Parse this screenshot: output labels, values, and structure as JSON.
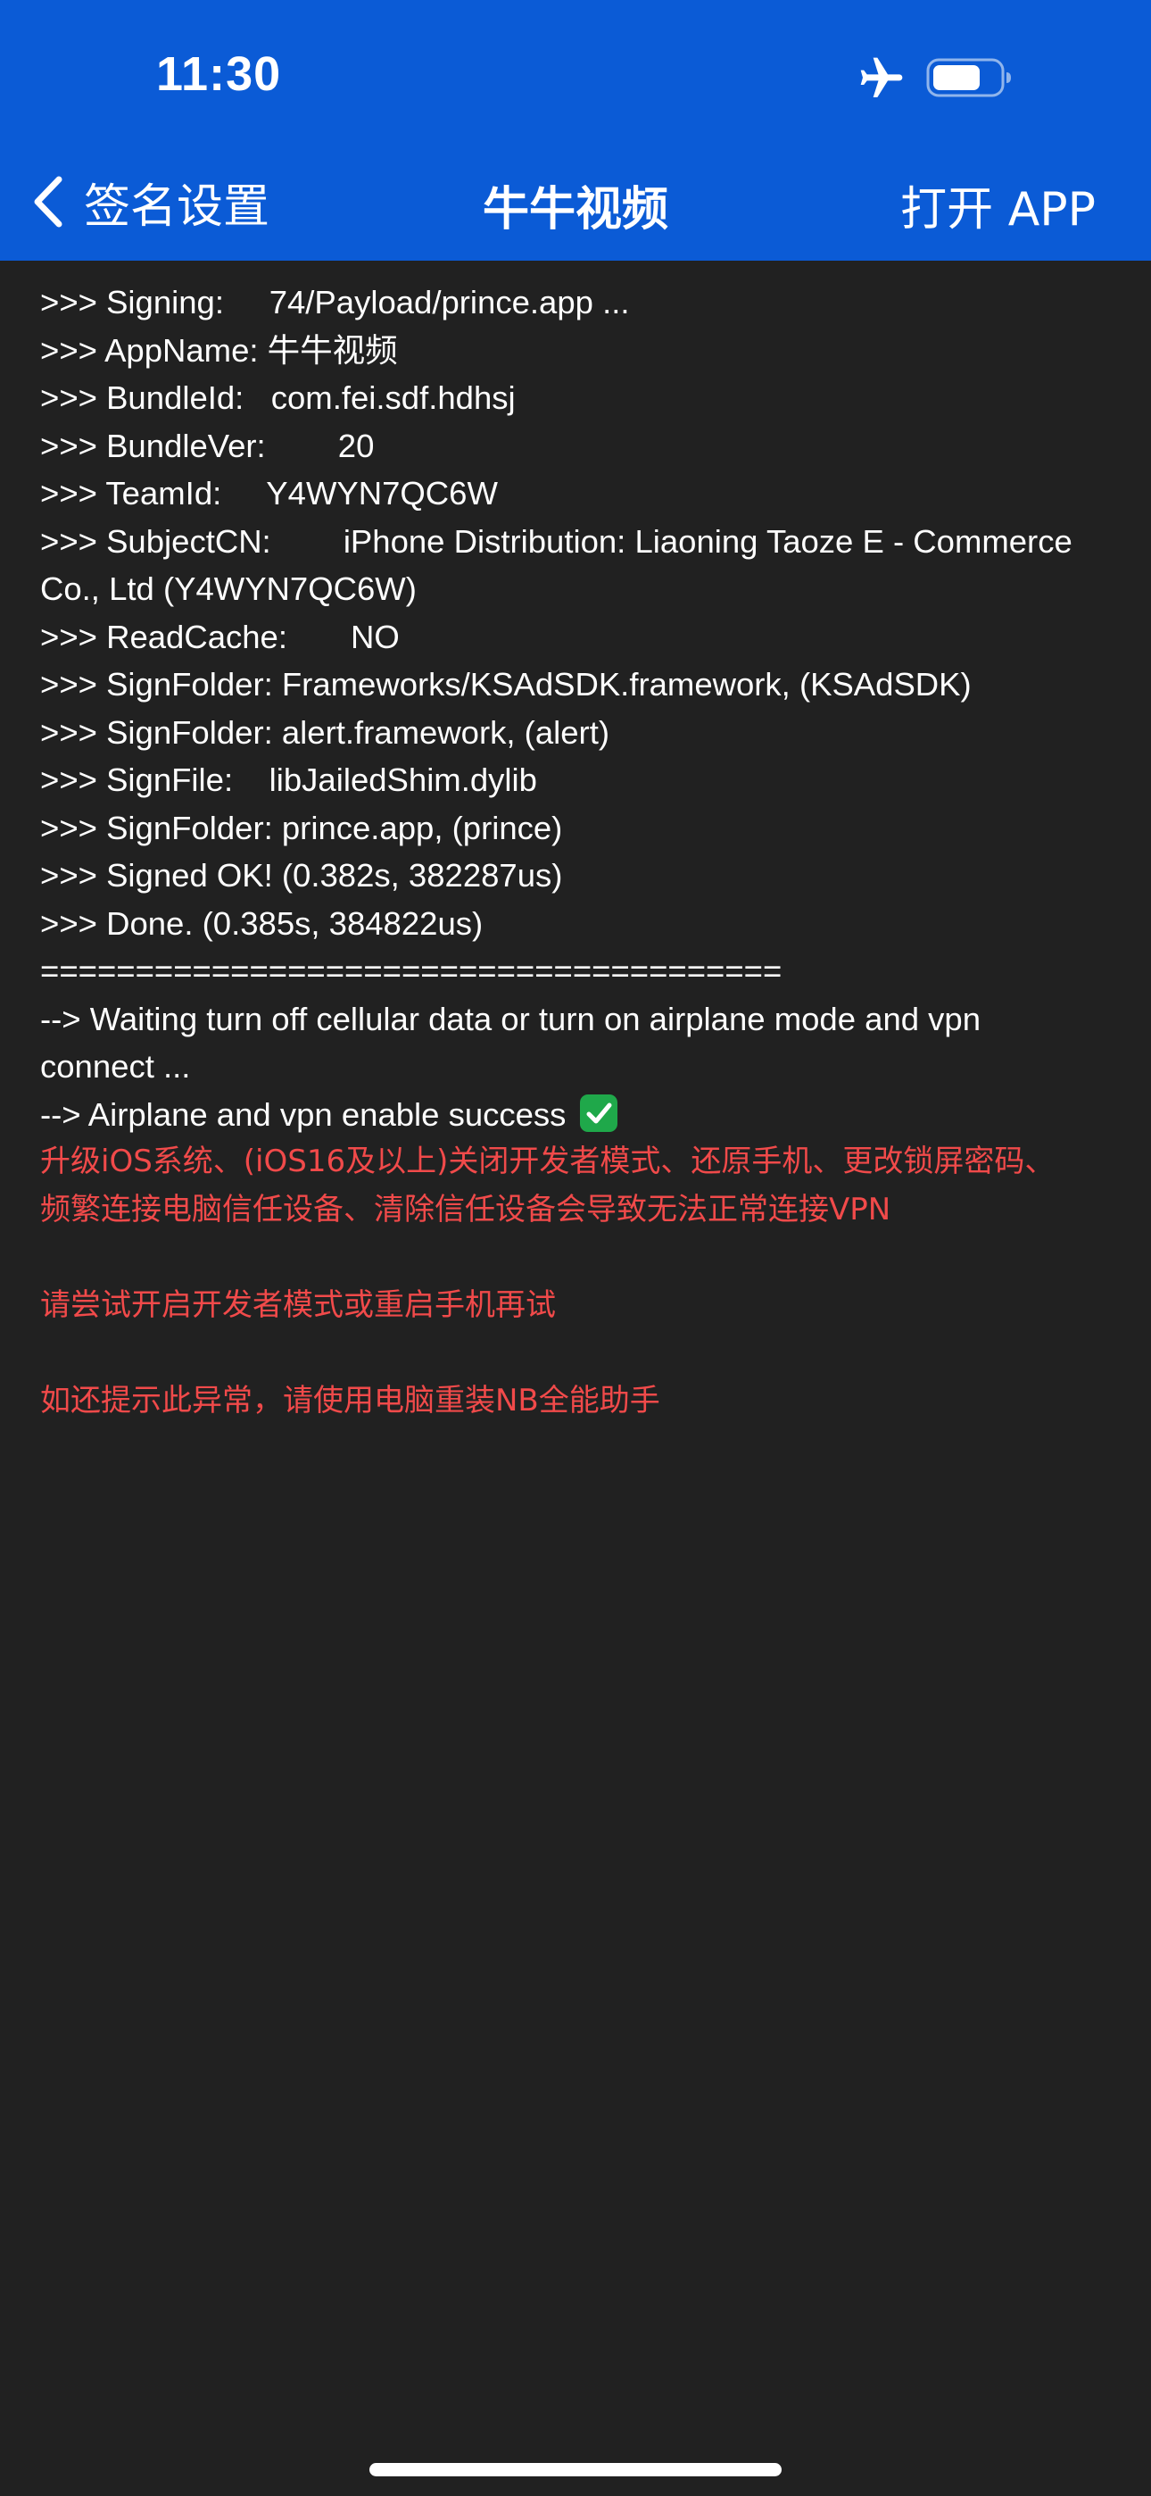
{
  "status_bar": {
    "time": "11:30"
  },
  "nav": {
    "back_label": "签名设置",
    "title": "牛牛视频",
    "right_action": "打开 APP"
  },
  "log_lines": [
    ">>> Signing:     74/Payload/prince.app ...",
    ">>> AppName: 牛牛视频",
    ">>> BundleId:   com.fei.sdf.hdhsj",
    ">>> BundleVer:        20",
    ">>> TeamId:     Y4WYN7QC6W",
    ">>> SubjectCN:        iPhone Distribution: Liaoning Taoze E - Commerce",
    "Co., Ltd (Y4WYN7QC6W)",
    ">>> ReadCache:       NO",
    ">>> SignFolder: Frameworks/KSAdSDK.framework, (KSAdSDK)",
    ">>> SignFolder: alert.framework, (alert)",
    ">>> SignFile:    libJailedShim.dylib",
    ">>> SignFolder: prince.app, (prince)",
    ">>> Signed OK! (0.382s, 382287us)",
    ">>> Done. (0.385s, 384822us)",
    "=======================================",
    "--> Waiting turn off cellular data or turn on airplane mode and vpn",
    "connect ...",
    "--> Airplane and vpn enable success"
  ],
  "error_lines": [
    "升级iOS系统、(iOS16及以上)关闭开发者模式、还原手机、更改锁屏密码、",
    "频繁连接电脑信任设备、清除信任设备会导致无法正常连接VPN",
    "请尝试开启开发者模式或重启手机再试",
    "如还提示此异常，请使用电脑重装NB全能助手"
  ],
  "colors": {
    "nav_background": "#0b5bd6",
    "log_background": "#212121",
    "log_text": "#ffffff",
    "error_text": "#f14a4a",
    "success_check": "#1fa84a"
  },
  "icons": {
    "status": [
      "airplane-icon",
      "battery-icon"
    ],
    "nav_back": "chevron-left-icon",
    "success": "check-mark-icon"
  }
}
